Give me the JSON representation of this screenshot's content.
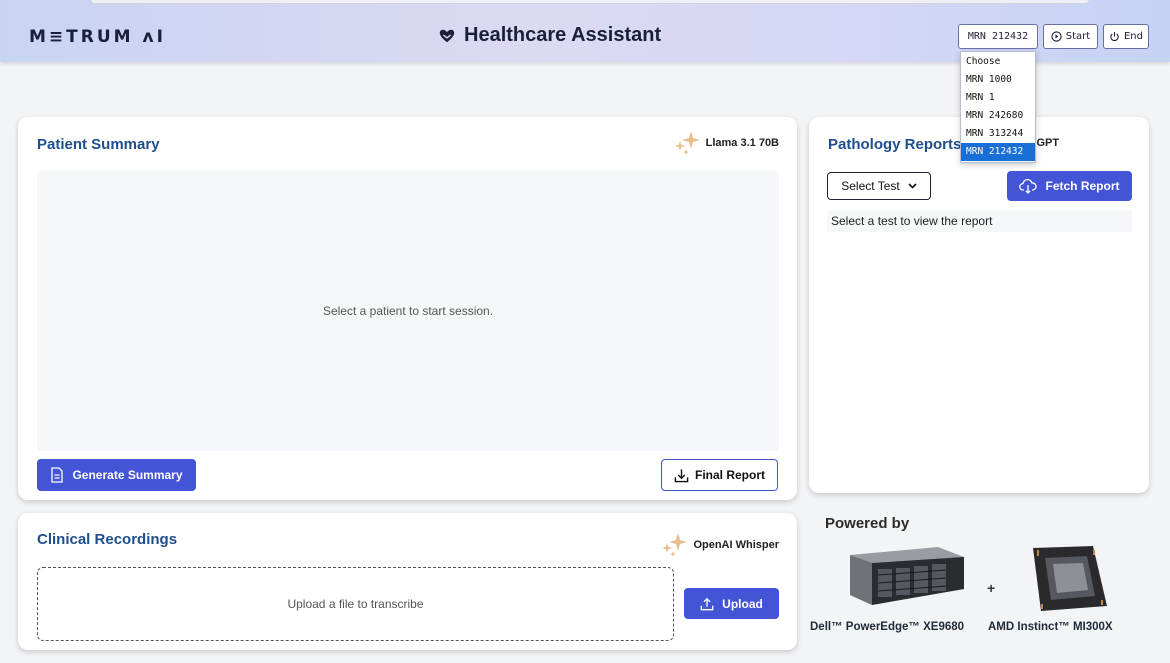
{
  "header": {
    "logo": "M≡TRUM ʌI",
    "title": "Healthcare Assistant",
    "mrn_selected": "MRN 212432",
    "start_label": "Start",
    "end_label": "End"
  },
  "mrn_dropdown": {
    "options": [
      "Choose",
      "MRN 1000",
      "MRN 1",
      "MRN 242680",
      "MRN 313244",
      "MRN 212432"
    ],
    "selected_index": 5
  },
  "patient_summary": {
    "title": "Patient Summary",
    "model": "Llama 3.1 70B",
    "placeholder": "Select a patient to start session.",
    "generate_label": "Generate Summary",
    "final_report_label": "Final Report"
  },
  "pathology": {
    "title": "Pathology Reports",
    "model": "HistoGPT",
    "select_label": "Select Test",
    "fetch_label": "Fetch Report",
    "message": "Select a test to view the report"
  },
  "recordings": {
    "title": "Clinical Recordings",
    "model": "OpenAI Whisper",
    "upload_zone": "Upload a file to transcribe",
    "upload_label": "Upload"
  },
  "powered_by": {
    "heading": "Powered by",
    "server": "Dell™ PowerEdge™ XE9680",
    "gpu": "AMD Instinct™ MI300X",
    "plus": "+"
  },
  "colors": {
    "accent": "#4454d6",
    "title_blue": "#1e4e8c",
    "dropdown_selected": "#1a6fd6"
  }
}
